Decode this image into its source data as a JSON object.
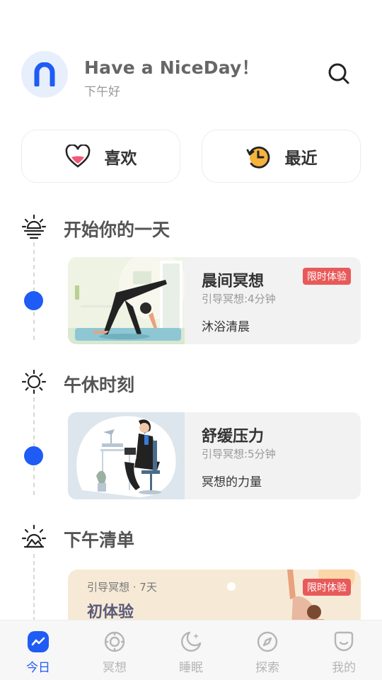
{
  "header": {
    "greeting": "Have a NiceDay！",
    "subtitle": "下午好"
  },
  "quick": {
    "like_label": "喜欢",
    "recent_label": "最近"
  },
  "sections": [
    {
      "title": "开始你的一天",
      "icon": "sunrise-icon",
      "card": {
        "title": "晨间冥想",
        "meta": "引导冥想:4分钟",
        "subtitle": "沐浴清晨",
        "badge": "限时体验"
      }
    },
    {
      "title": "午休时刻",
      "icon": "sun-icon",
      "card": {
        "title": "舒缓压力",
        "meta": "引导冥想:5分钟",
        "subtitle": "冥想的力量"
      }
    },
    {
      "title": "下午清单",
      "icon": "sunset-icon",
      "card": {
        "meta": "引导冥想 · 7天",
        "title": "初体验",
        "badge": "限时体验"
      }
    }
  ],
  "tabs": [
    {
      "label": "今日",
      "icon": "today-icon",
      "active": true
    },
    {
      "label": "冥想",
      "icon": "meditation-icon",
      "active": false
    },
    {
      "label": "睡眠",
      "icon": "moon-icon",
      "active": false
    },
    {
      "label": "探索",
      "icon": "compass-icon",
      "active": false
    },
    {
      "label": "我的",
      "icon": "profile-icon",
      "active": false
    }
  ],
  "colors": {
    "accent": "#1e5cf5",
    "badge": "#e85a5a",
    "inactive_tab": "#b5b5b5"
  }
}
